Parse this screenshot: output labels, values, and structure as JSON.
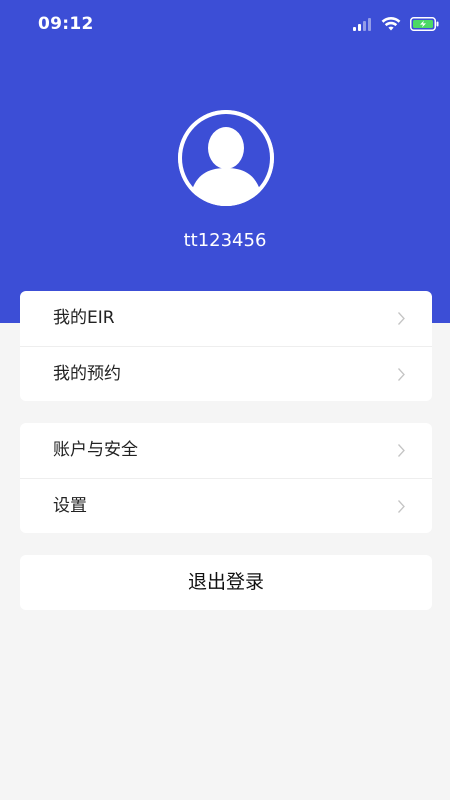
{
  "status_bar": {
    "time": "09:12",
    "icons": [
      "signal-icon",
      "wifi-icon",
      "battery-charging-icon"
    ]
  },
  "colors": {
    "header_bg": "#3c4ed6",
    "page_bg": "#f5f5f5",
    "battery_fill": "#4cd964"
  },
  "profile": {
    "avatar_icon": "user-avatar-icon",
    "username": "tt123456"
  },
  "menu_groups": [
    {
      "items": [
        {
          "label": "我的EIR",
          "icon": "chevron-right-icon"
        },
        {
          "label": "我的预约",
          "icon": "chevron-right-icon"
        }
      ]
    },
    {
      "items": [
        {
          "label": "账户与安全",
          "icon": "chevron-right-icon"
        },
        {
          "label": "设置",
          "icon": "chevron-right-icon"
        }
      ]
    }
  ],
  "logout": {
    "label": "退出登录"
  }
}
